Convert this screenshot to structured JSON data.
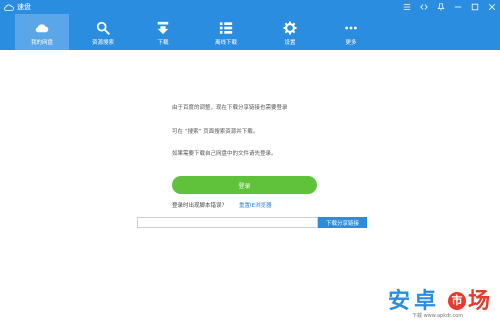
{
  "app": {
    "title": "速盘"
  },
  "window_controls": {
    "menu_icon": "menu-lines-icon",
    "link_icon": "code-link-icon"
  },
  "nav": [
    {
      "label": "我的网盘",
      "icon": "cloud-icon",
      "active": true
    },
    {
      "label": "资源搜索",
      "icon": "search-icon",
      "active": false
    },
    {
      "label": "下载",
      "icon": "download-icon",
      "active": false
    },
    {
      "label": "离线下载",
      "icon": "list-icon",
      "active": false
    },
    {
      "label": "设置",
      "icon": "gear-icon",
      "active": false
    },
    {
      "label": "更多",
      "icon": "more-icon",
      "active": false
    }
  ],
  "main": {
    "message_line1": "由于百度的调整，现在下载分享链接也需要登录",
    "message_line2": "可在 “搜索” 页面搜索资源并下载。",
    "message_line3": "如果需要下载自己网盘中的文件请先登录。",
    "login_button": "登录",
    "login_issue_text": "登录时出现脚本错误？",
    "reset_browser_link": "重置IE浏览器",
    "share_input_value": "",
    "share_input_placeholder": "",
    "download_share_button": "下载分享链接"
  },
  "watermark": {
    "an": "安",
    "zhuo": "卓",
    "shi": "市",
    "chang": "场",
    "url": "下载 www.apkdr.com"
  },
  "colors": {
    "accent": "#2b8de0",
    "active_tab": "#5aa6e8",
    "login_green": "#60c23a",
    "link": "#2b7fd6"
  }
}
